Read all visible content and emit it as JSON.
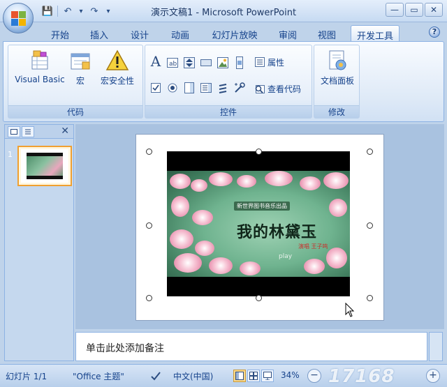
{
  "window": {
    "title": "演示文稿1 - Microsoft PowerPoint",
    "controls": {
      "minimize": "—",
      "maximize": "▭",
      "close": "✕"
    }
  },
  "qat": {
    "save": "💾",
    "undo": "↶",
    "undo_dd": "▾",
    "redo": "↷",
    "more": "▾"
  },
  "tabs": [
    "开始",
    "插入",
    "设计",
    "动画",
    "幻灯片放映",
    "审阅",
    "视图",
    "开发工具"
  ],
  "active_tab": "开发工具",
  "help": "?",
  "ribbon": {
    "code": {
      "label": "代码",
      "visual_basic": "Visual Basic",
      "macros": "宏",
      "macro_security": "宏安全性"
    },
    "controls": {
      "label": "控件",
      "properties": "属性",
      "view_code": "查看代码",
      "text_a": "A"
    },
    "modify": {
      "label": "修改",
      "document_panel": "文档面板"
    }
  },
  "left_pane": {
    "close": "✕",
    "slide_number": "1"
  },
  "slide": {
    "video": {
      "subtitle": "新世界图书音乐出品",
      "title": "我的林黛玉",
      "credit": "演唱  王子鸣",
      "play": "play"
    }
  },
  "notes": {
    "placeholder": "单击此处添加备注"
  },
  "status": {
    "slide": "幻灯片 1/1",
    "theme": "\"Office 主题\"",
    "language": "中文(中国)",
    "zoom": "34%",
    "watermark": "17168"
  },
  "colors": {
    "ribbon_text": "#15428b",
    "thumb_border": "#f0a030",
    "active_view": "#fbd88a"
  }
}
